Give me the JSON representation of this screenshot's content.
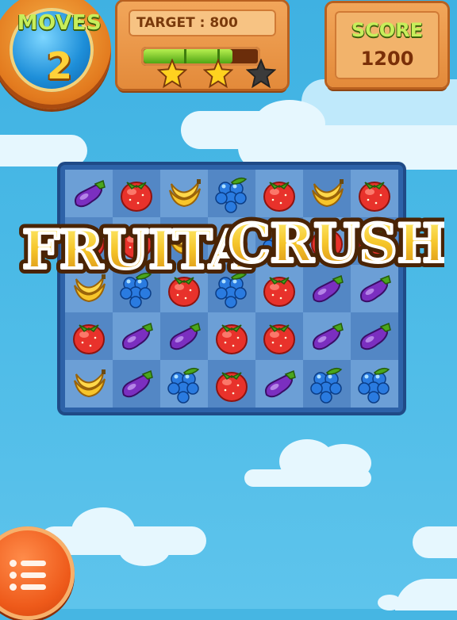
{
  "hud": {
    "moves_label": "MOVES",
    "moves_value": "2",
    "target_label": "TARGET : 800",
    "target_progress": 0.78,
    "stars_earned": 2,
    "stars_total": 3,
    "score_label": "SCORE",
    "score_value": "1200"
  },
  "logo": {
    "text_1": "FRUITA",
    "text_2": "CRUSH!"
  },
  "board": {
    "rows": 5,
    "cols": 7,
    "grid": [
      [
        "eggplant",
        "strawberry",
        "banana",
        "grapes",
        "strawberry",
        "banana",
        "strawberry"
      ],
      [
        "strawberry",
        "strawberry",
        "banana",
        "strawberry",
        "grapes",
        "strawberry",
        "strawberry"
      ],
      [
        "banana",
        "grapes",
        "strawberry",
        "grapes",
        "strawberry",
        "eggplant",
        "eggplant"
      ],
      [
        "strawberry",
        "eggplant",
        "eggplant",
        "strawberry",
        "strawberry",
        "eggplant",
        "eggplant"
      ],
      [
        "banana",
        "eggplant",
        "grapes",
        "strawberry",
        "eggplant",
        "grapes",
        "grapes"
      ]
    ]
  },
  "menu_button": {
    "icon": "menu-list-icon"
  },
  "colors": {
    "sky": "#46b6e3",
    "panel": "#e38a3a",
    "board": "#2d62a8",
    "logo_fill": "#f5c52a"
  }
}
